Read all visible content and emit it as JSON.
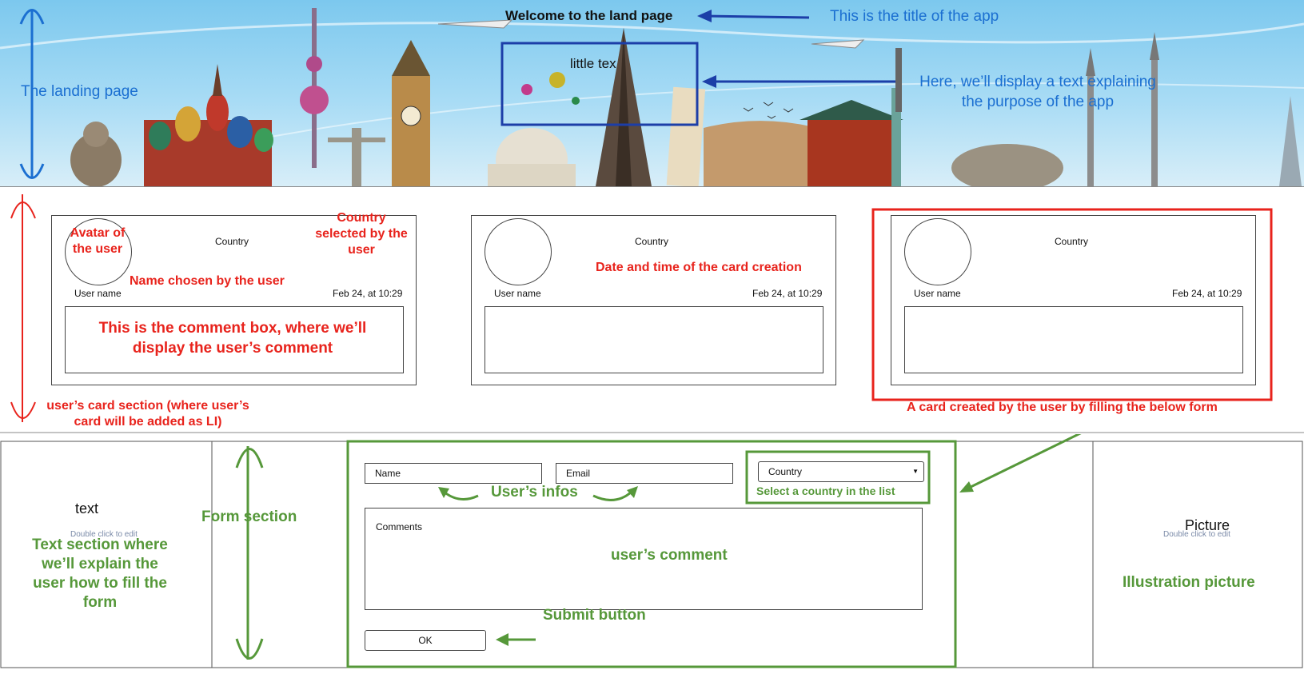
{
  "hero": {
    "title": "Welcome to the land page",
    "little_text": "little tex",
    "ann_title": "This is the title of the app",
    "ann_landing": "The landing page",
    "ann_purpose": "Here, we’ll display a text explaining the purpose of the app"
  },
  "cards": [
    {
      "country": "Country",
      "user": "User name",
      "date": "Feb 24, at 10:29"
    },
    {
      "country": "Country",
      "user": "User name",
      "date": "Feb 24, at 10:29"
    },
    {
      "country": "Country",
      "user": "User name",
      "date": "Feb 24, at 10:29"
    }
  ],
  "card_annotations": {
    "avatar": "Avatar of the user",
    "country": "Country selected by the user",
    "name": "Name chosen by the user",
    "comment": "This is the comment box, where we’ll display the user’s comment",
    "date": "Date and time of the card creation",
    "section": "user’s card section (where user’s card will be added as LI)",
    "created": "A card created by the user by filling the below form"
  },
  "form": {
    "name_placeholder": "Name",
    "email_placeholder": "Email",
    "country_value": "Country",
    "comments_placeholder": "Comments",
    "ok_label": "OK"
  },
  "bottom": {
    "text_label": "text",
    "double_click_1": "Double click to edit",
    "picture_label": "Picture",
    "double_click_2": "Double click to edit"
  },
  "form_annotations": {
    "user_infos": "User’s infos",
    "select_country": "Select a country in the list",
    "form_section": "Form section",
    "user_comment": "user’s comment",
    "submit": "Submit button",
    "text_section": "Text section where we’ll explain the user how to fill the form",
    "illustration": "Illustration picture"
  },
  "colors": {
    "blue": "#1b6fd1",
    "red": "#e8231c",
    "green": "#56983a"
  }
}
